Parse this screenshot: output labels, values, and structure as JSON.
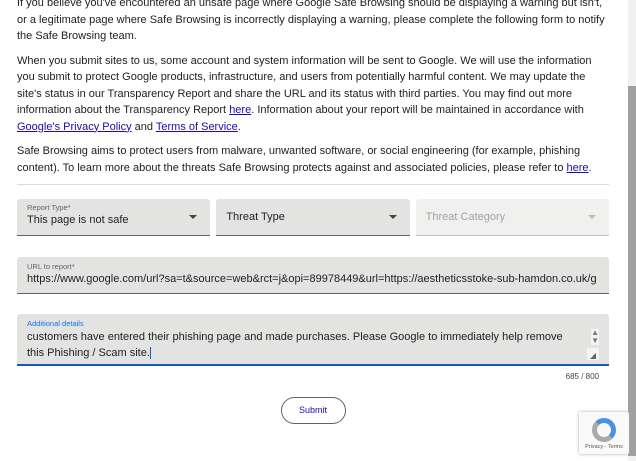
{
  "intro": {
    "p1": "If you believe you've encountered an unsafe page where Google Safe Browsing should be displaying a warning but isn't, or a legitimate page where Safe Browsing is incorrectly displaying a warning, please complete the following form to notify the Safe Browsing team.",
    "p2a": "When you submit sites to us, some account and system information will be sent to Google. We will use the information you submit to protect Google products, infrastructure, and users from potentially harmful content. We may update the site's status in our Transparency Report and share the URL and its status with third parties. You may find out more information about the Transparency Report ",
    "p2_link1": "here",
    "p2b": ". Information about your report will be maintained in accordance with ",
    "p2_link2": "Google's Privacy Policy",
    "p2c": " and ",
    "p2_link3": "Terms of Service",
    "p2d": ".",
    "p3a": "Safe Browsing aims to protect users from malware, unwanted software, or social engineering (for example, phishing content). To learn more about the threats Safe Browsing protects against and associated policies, please refer to ",
    "p3_link": "here",
    "p3b": "."
  },
  "form": {
    "report_type_label": "Report Type*",
    "report_type_value": "This page is not safe",
    "threat_type_placeholder": "Threat Type",
    "threat_category_placeholder": "Threat Category",
    "url_label": "URL to report*",
    "url_value": "https://www.google.com/url?sa=t&source=web&rct=j&opi=89978449&url=https://aestheticsstoke-sub-hamdon.co.uk/g",
    "details_label": "Additional details",
    "details_value": "customers have entered their phishing page and made purchases. Please Google to immediately help remove this Phishing / Scam site.",
    "char_count": "685 / 800",
    "submit_label": "Submit"
  },
  "recaptcha": {
    "links": "Privacy - Terms"
  }
}
